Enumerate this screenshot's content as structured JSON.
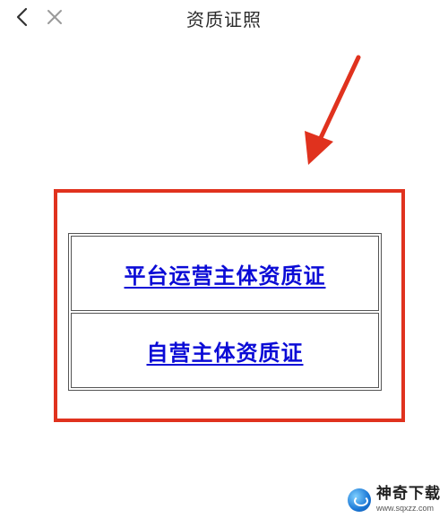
{
  "navbar": {
    "back_icon": "chevron-left-icon",
    "close_icon": "close-icon",
    "title": "资质证照"
  },
  "annotation": {
    "color": "#e0321e"
  },
  "links": [
    {
      "label": "平台运营主体资质证"
    },
    {
      "label": "自营主体资质证"
    }
  ],
  "watermark": {
    "name": "神奇下载",
    "url": "www.sqxzz.com"
  },
  "colors": {
    "link": "#0b0bd6",
    "highlight": "#e0321e",
    "title": "#2b2b2b"
  }
}
